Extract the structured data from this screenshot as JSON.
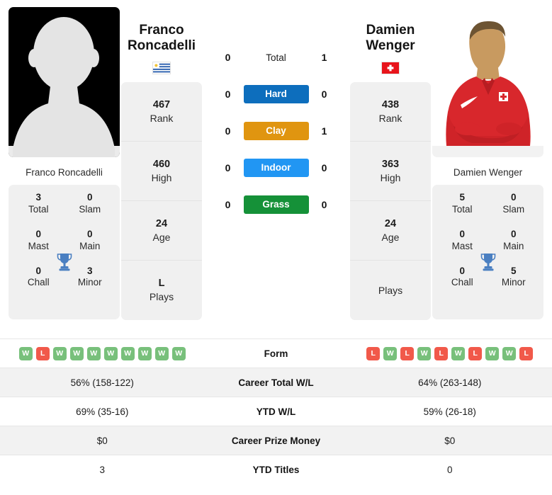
{
  "players": {
    "left": {
      "first_name": "Franco",
      "last_name": "Roncadelli",
      "full_name": "Franco Roncadelli",
      "country": "uruguay",
      "photo": "silhouette-placeholder",
      "rank": "467",
      "rank_label": "Rank",
      "high": "460",
      "high_label": "High",
      "age": "24",
      "age_label": "Age",
      "plays": "L",
      "plays_label": "Plays",
      "titles": {
        "total": "3",
        "total_label": "Total",
        "slam": "0",
        "slam_label": "Slam",
        "mast": "0",
        "mast_label": "Mast",
        "main": "0",
        "main_label": "Main",
        "chall": "0",
        "chall_label": "Chall",
        "minor": "3",
        "minor_label": "Minor"
      },
      "form": [
        "W",
        "L",
        "W",
        "W",
        "W",
        "W",
        "W",
        "W",
        "W",
        "W"
      ],
      "career_wl": "56% (158-122)",
      "ytd_wl": "69% (35-16)",
      "career_prize": "$0",
      "ytd_titles": "3"
    },
    "right": {
      "first_name": "Damien",
      "last_name": "Wenger",
      "full_name": "Damien Wenger",
      "country": "switzerland",
      "photo": "player-portrait",
      "rank": "438",
      "rank_label": "Rank",
      "high": "363",
      "high_label": "High",
      "age": "24",
      "age_label": "Age",
      "plays": "",
      "plays_label": "Plays",
      "titles": {
        "total": "5",
        "total_label": "Total",
        "slam": "0",
        "slam_label": "Slam",
        "mast": "0",
        "mast_label": "Mast",
        "main": "0",
        "main_label": "Main",
        "chall": "0",
        "chall_label": "Chall",
        "minor": "5",
        "minor_label": "Minor"
      },
      "form": [
        "L",
        "W",
        "L",
        "W",
        "L",
        "W",
        "L",
        "W",
        "W",
        "L"
      ],
      "career_wl": "64% (263-148)",
      "ytd_wl": "59% (26-18)",
      "career_prize": "$0",
      "ytd_titles": "0"
    }
  },
  "h2h": [
    {
      "label": "Total",
      "left": "0",
      "right": "1",
      "style": "plain",
      "color": ""
    },
    {
      "label": "Hard",
      "left": "0",
      "right": "0",
      "style": "bar",
      "color": "#0d6ebd"
    },
    {
      "label": "Clay",
      "left": "0",
      "right": "1",
      "style": "bar",
      "color": "#e09510"
    },
    {
      "label": "Indoor",
      "left": "0",
      "right": "0",
      "style": "bar",
      "color": "#2196f3"
    },
    {
      "label": "Grass",
      "left": "0",
      "right": "0",
      "style": "bar",
      "color": "#159138"
    }
  ],
  "table": {
    "rows": [
      {
        "label": "Form",
        "type": "form",
        "key": "form"
      },
      {
        "label": "Career Total W/L",
        "type": "text",
        "key": "career_wl"
      },
      {
        "label": "YTD W/L",
        "type": "text",
        "key": "ytd_wl"
      },
      {
        "label": "Career Prize Money",
        "type": "text",
        "key": "career_prize"
      },
      {
        "label": "YTD Titles",
        "type": "text",
        "key": "ytd_titles"
      }
    ]
  },
  "colors": {
    "win_badge": "#78c07b",
    "loss_badge": "#f1594a",
    "card_bg": "#f0f0f0",
    "row_alt_bg": "#f2f2f2"
  }
}
